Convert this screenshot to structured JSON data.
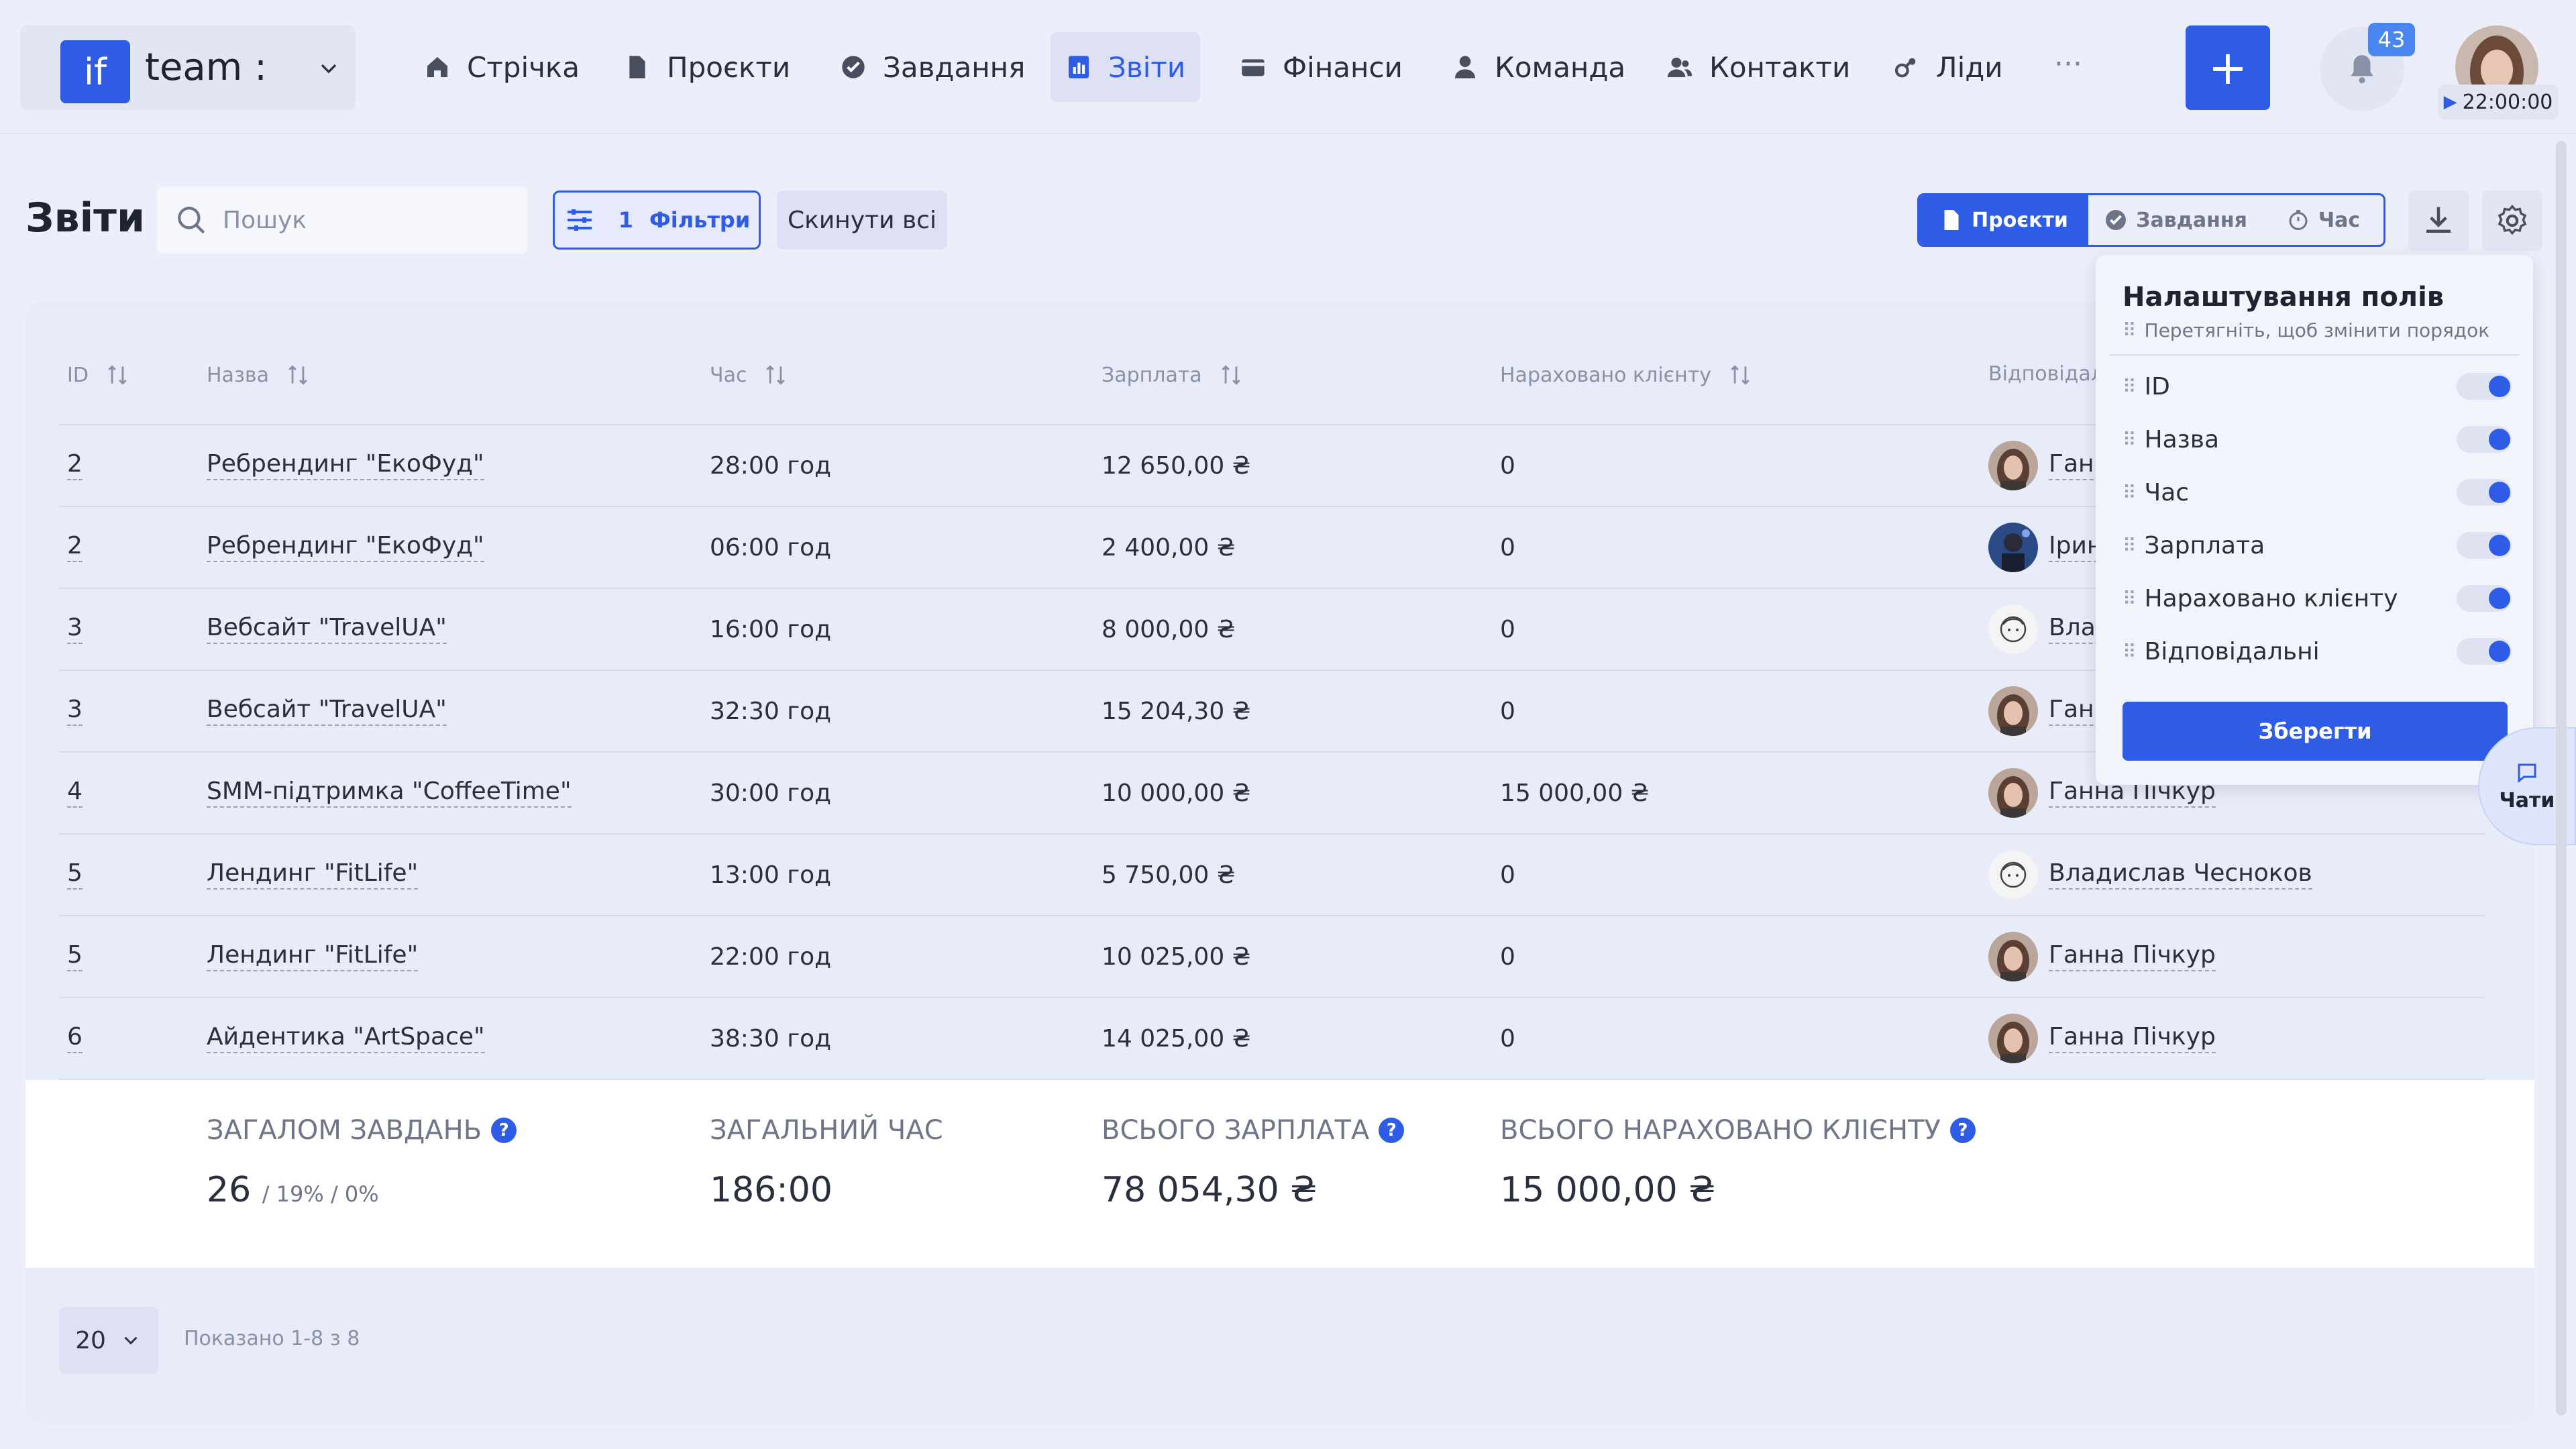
{
  "header": {
    "logo_text": "if",
    "team_name": "team :",
    "nav": [
      {
        "label": "Стрічка",
        "icon": "home-icon"
      },
      {
        "label": "Проєкти",
        "icon": "document-icon"
      },
      {
        "label": "Завдання",
        "icon": "check-circle-icon"
      },
      {
        "label": "Звіти",
        "icon": "report-icon",
        "active": true
      },
      {
        "label": "Фінанси",
        "icon": "wallet-icon"
      },
      {
        "label": "Команда",
        "icon": "person-icon"
      },
      {
        "label": "Контакти",
        "icon": "contacts-icon"
      },
      {
        "label": "Ліди",
        "icon": "leads-icon"
      }
    ],
    "more": "···",
    "add": "+",
    "notifications_count": "43",
    "timer": "22:00:00"
  },
  "page": {
    "title": "Звіти",
    "search_placeholder": "Пошук",
    "filters_count": "1",
    "filters_label": "Фільтри",
    "reset_label": "Скинути всі",
    "view_tabs": [
      {
        "label": "Проєкти",
        "active": true
      },
      {
        "label": "Завдання",
        "active": false
      },
      {
        "label": "Час",
        "active": false
      }
    ]
  },
  "table": {
    "columns": [
      "ID",
      "Назва",
      "Час",
      "Зарплата",
      "Нараховано клієнту",
      "Відповідальні"
    ],
    "rows": [
      {
        "id": "2",
        "name": "Ребрендинг \"ЕкоФуд\"",
        "time": "28:00 год",
        "salary": "12 650,00 ₴",
        "billed": "0",
        "resp": "Ганна Пічкур",
        "avatar": "photo-woman"
      },
      {
        "id": "2",
        "name": "Ребрендинг \"ЕкоФуд\"",
        "time": "06:00 год",
        "salary": "2 400,00 ₴",
        "billed": "0",
        "resp": "Ірина",
        "avatar": "photo-blue"
      },
      {
        "id": "3",
        "name": "Вебсайт \"TravelUA\"",
        "time": "16:00 год",
        "salary": "8 000,00 ₴",
        "billed": "0",
        "resp": "Владислав Чесноков",
        "avatar": "line-face"
      },
      {
        "id": "3",
        "name": "Вебсайт \"TravelUA\"",
        "time": "32:30 год",
        "salary": "15 204,30 ₴",
        "billed": "0",
        "resp": "Ганна Пічкур",
        "avatar": "photo-woman"
      },
      {
        "id": "4",
        "name": "SMM-підтримка \"CoffeeTime\"",
        "time": "30:00 год",
        "salary": "10 000,00 ₴",
        "billed": "15 000,00 ₴",
        "resp": "Ганна Пічкур",
        "avatar": "photo-woman"
      },
      {
        "id": "5",
        "name": "Лендинг \"FitLife\"",
        "time": "13:00 год",
        "salary": "5 750,00 ₴",
        "billed": "0",
        "resp": "Владислав Чесноков",
        "avatar": "line-face"
      },
      {
        "id": "5",
        "name": "Лендинг \"FitLife\"",
        "time": "22:00 год",
        "salary": "10 025,00 ₴",
        "billed": "0",
        "resp": "Ганна Пічкур",
        "avatar": "photo-woman"
      },
      {
        "id": "6",
        "name": "Айдентика \"ArtSpace\"",
        "time": "38:30 год",
        "salary": "14 025,00 ₴",
        "billed": "0",
        "resp": "Ганна Пічкур",
        "avatar": "photo-woman"
      }
    ]
  },
  "totals": {
    "tasks_label": "ЗАГАЛОМ ЗАВДАНЬ",
    "tasks_value": "26",
    "tasks_pct": "/ 19% / 0%",
    "time_label": "ЗАГАЛЬНИЙ ЧАС",
    "time_value": "186:00",
    "salary_label": "ВСЬОГО ЗАРПЛАТА",
    "salary_value": "78 054,30 ₴",
    "billed_label": "ВСЬОГО НАРАХОВАНО КЛІЄНТУ",
    "billed_value": "15 000,00 ₴",
    "help": "?"
  },
  "pagination": {
    "per_page": "20",
    "info": "Показано 1-8 з 8"
  },
  "settings_panel": {
    "title": "Налаштування полів",
    "subtitle": "Перетягніть, щоб змінити порядок",
    "fields": [
      "ID",
      "Назва",
      "Час",
      "Зарплата",
      "Нараховано клієнту",
      "Відповідальні"
    ],
    "save": "Зберегти"
  },
  "chats_label": "Чати",
  "colors": {
    "accent": "#2e5ce6",
    "background": "#eceef9"
  }
}
